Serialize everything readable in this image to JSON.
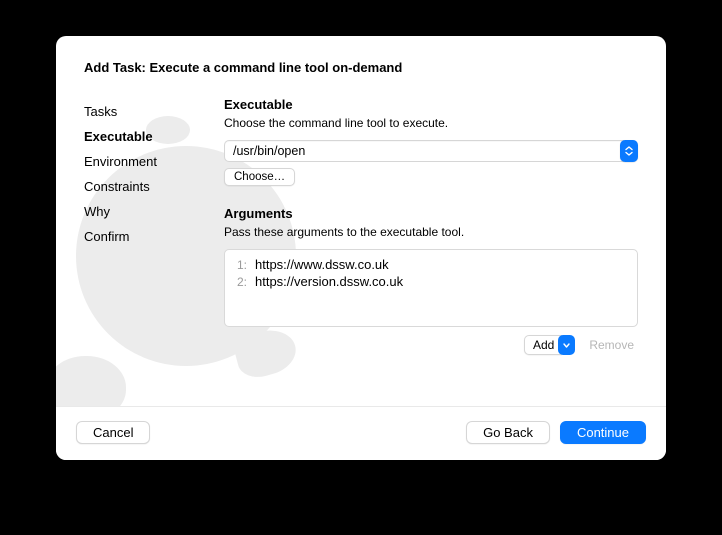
{
  "title": "Add Task: Execute a command line tool on-demand",
  "sidebar": {
    "items": [
      {
        "label": "Tasks",
        "active": false
      },
      {
        "label": "Executable",
        "active": true
      },
      {
        "label": "Environment",
        "active": false
      },
      {
        "label": "Constraints",
        "active": false
      },
      {
        "label": "Why",
        "active": false
      },
      {
        "label": "Confirm",
        "active": false
      }
    ]
  },
  "executable": {
    "heading": "Executable",
    "description": "Choose the command line tool to execute.",
    "path": "/usr/bin/open",
    "choose_label": "Choose…"
  },
  "arguments": {
    "heading": "Arguments",
    "description": "Pass these arguments to the executable tool.",
    "items": [
      "https://www.dssw.co.uk",
      "https://version.dssw.co.uk"
    ],
    "add_label": "Add",
    "remove_label": "Remove"
  },
  "footer": {
    "cancel_label": "Cancel",
    "back_label": "Go Back",
    "continue_label": "Continue"
  }
}
